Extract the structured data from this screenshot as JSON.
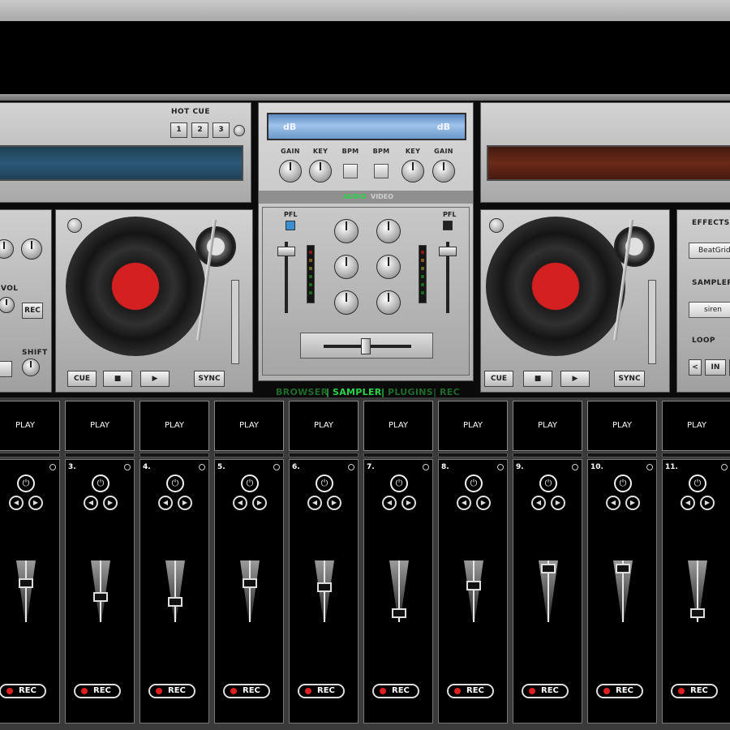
{
  "deckA": {
    "hotcue_label": "HOT CUE",
    "hotcue_buttons": [
      "1",
      "2",
      "3"
    ],
    "cue_label": "CUE",
    "stop_icon": "stop-icon",
    "play_icon": "play-icon",
    "sync_label": "SYNC",
    "waveform_color": "#2c5977"
  },
  "deckB": {
    "cue_label": "CUE",
    "sync_label": "SYNC",
    "waveform_color": "#6b2a18"
  },
  "left_panel": {
    "vol_label": "VOL",
    "rec_label": "REC",
    "shift_label": "SHIFT"
  },
  "right_panel": {
    "effects_label": "EFFECTS",
    "effect_value": "BeatGrid",
    "sampler_label": "SAMPLER",
    "sampler_value": "siren",
    "loop_label": "LOOP",
    "loop_prev": "<",
    "loop_in": "IN"
  },
  "mixer": {
    "display_left": "dB",
    "display_right": "dB",
    "labels": [
      "GAIN",
      "KEY",
      "BPM",
      "BPM",
      "KEY",
      "GAIN"
    ],
    "audio_tab": "AUDIO",
    "video_tab": "VIDEO",
    "pfl_left": "PFL",
    "pfl_right": "PFL"
  },
  "tabs": {
    "browser": "BROWSER",
    "sep1": "|",
    "sampler": "SAMPLER",
    "sep2": "|",
    "plugins": "PLUGINS",
    "sep3": "|",
    "rec": "REC",
    "active_color": "#2bd24a",
    "inactive_color": "#1f6a2a"
  },
  "samplers": [
    {
      "play": "PLAY",
      "num": "",
      "rec": "REC",
      "volume": 0.65
    },
    {
      "play": "PLAY",
      "num": "3.",
      "rec": "REC",
      "volume": 0.39
    },
    {
      "play": "PLAY",
      "num": "4.",
      "rec": "REC",
      "volume": 0.29
    },
    {
      "play": "PLAY",
      "num": "5.",
      "rec": "REC",
      "volume": 0.65
    },
    {
      "play": "PLAY",
      "num": "6.",
      "rec": "REC",
      "volume": 0.58
    },
    {
      "play": "PLAY",
      "num": "7.",
      "rec": "REC",
      "volume": 0.08
    },
    {
      "play": "PLAY",
      "num": "8.",
      "rec": "REC",
      "volume": 0.61
    },
    {
      "play": "PLAY",
      "num": "9.",
      "rec": "REC",
      "volume": 0.93
    },
    {
      "play": "PLAY",
      "num": "10.",
      "rec": "REC",
      "volume": 0.93
    },
    {
      "play": "PLAY",
      "num": "11.",
      "rec": "REC",
      "volume": 0.08
    }
  ]
}
